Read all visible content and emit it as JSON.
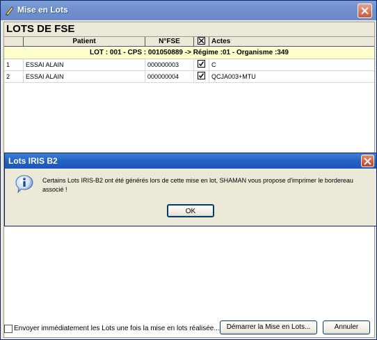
{
  "window": {
    "title": "Mise en Lots",
    "icon": "pencil-icon"
  },
  "section": {
    "title": "LOTS DE FSE"
  },
  "table": {
    "columns": [
      "",
      "Patient",
      "N°FSE",
      "",
      "Actes"
    ],
    "lot_header": "LOT : 001  -  CPS : 001050889 -> Régime :01 - Organisme :349",
    "rows": [
      {
        "num": "1",
        "patient": "ESSAI ALAIN",
        "fse": "000000003",
        "checked": true,
        "actes": "C"
      },
      {
        "num": "2",
        "patient": "ESSAI ALAIN",
        "fse": "000000004",
        "checked": true,
        "actes": "QCJA003+MTU"
      }
    ]
  },
  "footer": {
    "send_label": "Envoyer immédiatement les Lots une fois la mise en lots réalisée...",
    "start_button": "Démarrer la Mise en Lots...",
    "cancel_button": "Annuler"
  },
  "dialog": {
    "title": "Lots IRIS B2",
    "message": "Certains Lots IRIS-B2 ont été générés lors de cette mise en lot, SHAMAN vous propose d'imprimer le bordereau associé !",
    "ok_button": "OK",
    "icon": "info-icon"
  },
  "colors": {
    "lot_row_bg": "#ffffcc",
    "dialog_title": "#2562c4",
    "main_title": "#7f9fd6"
  }
}
